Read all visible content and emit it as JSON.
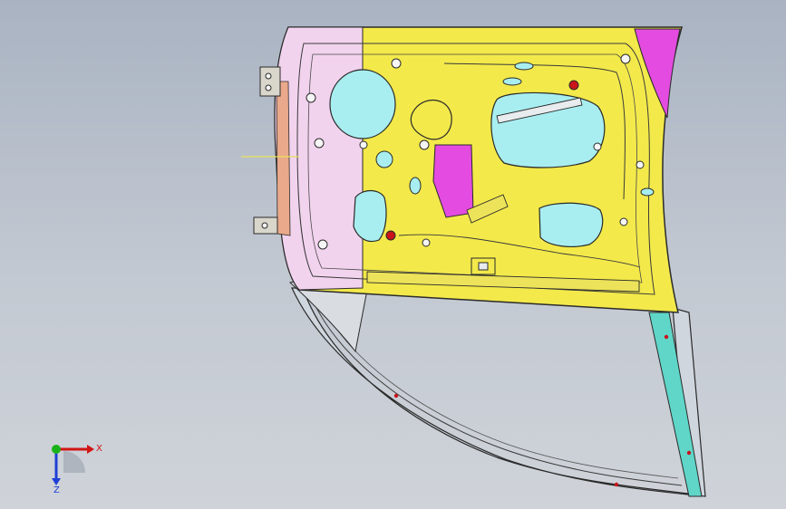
{
  "viewport": {
    "background_top": "#a9b3c2",
    "background_bottom": "#cfd3d9"
  },
  "model": {
    "colors": {
      "inner_panel": "#f3e94a",
      "hinge_side_panel": "#f2d3ee",
      "reinforcement": "#e44be0",
      "access_holes": "#a8eef0",
      "window_frame_edge": "#5fd6c8",
      "outline": "#2a2a2a",
      "red_marker": "#c8141a"
    }
  },
  "triad": {
    "x_label": "X",
    "y_label": "Y",
    "z_label": "Z",
    "x_color": "#d21414",
    "y_color": "#19b319",
    "z_color": "#1e3fd6"
  }
}
